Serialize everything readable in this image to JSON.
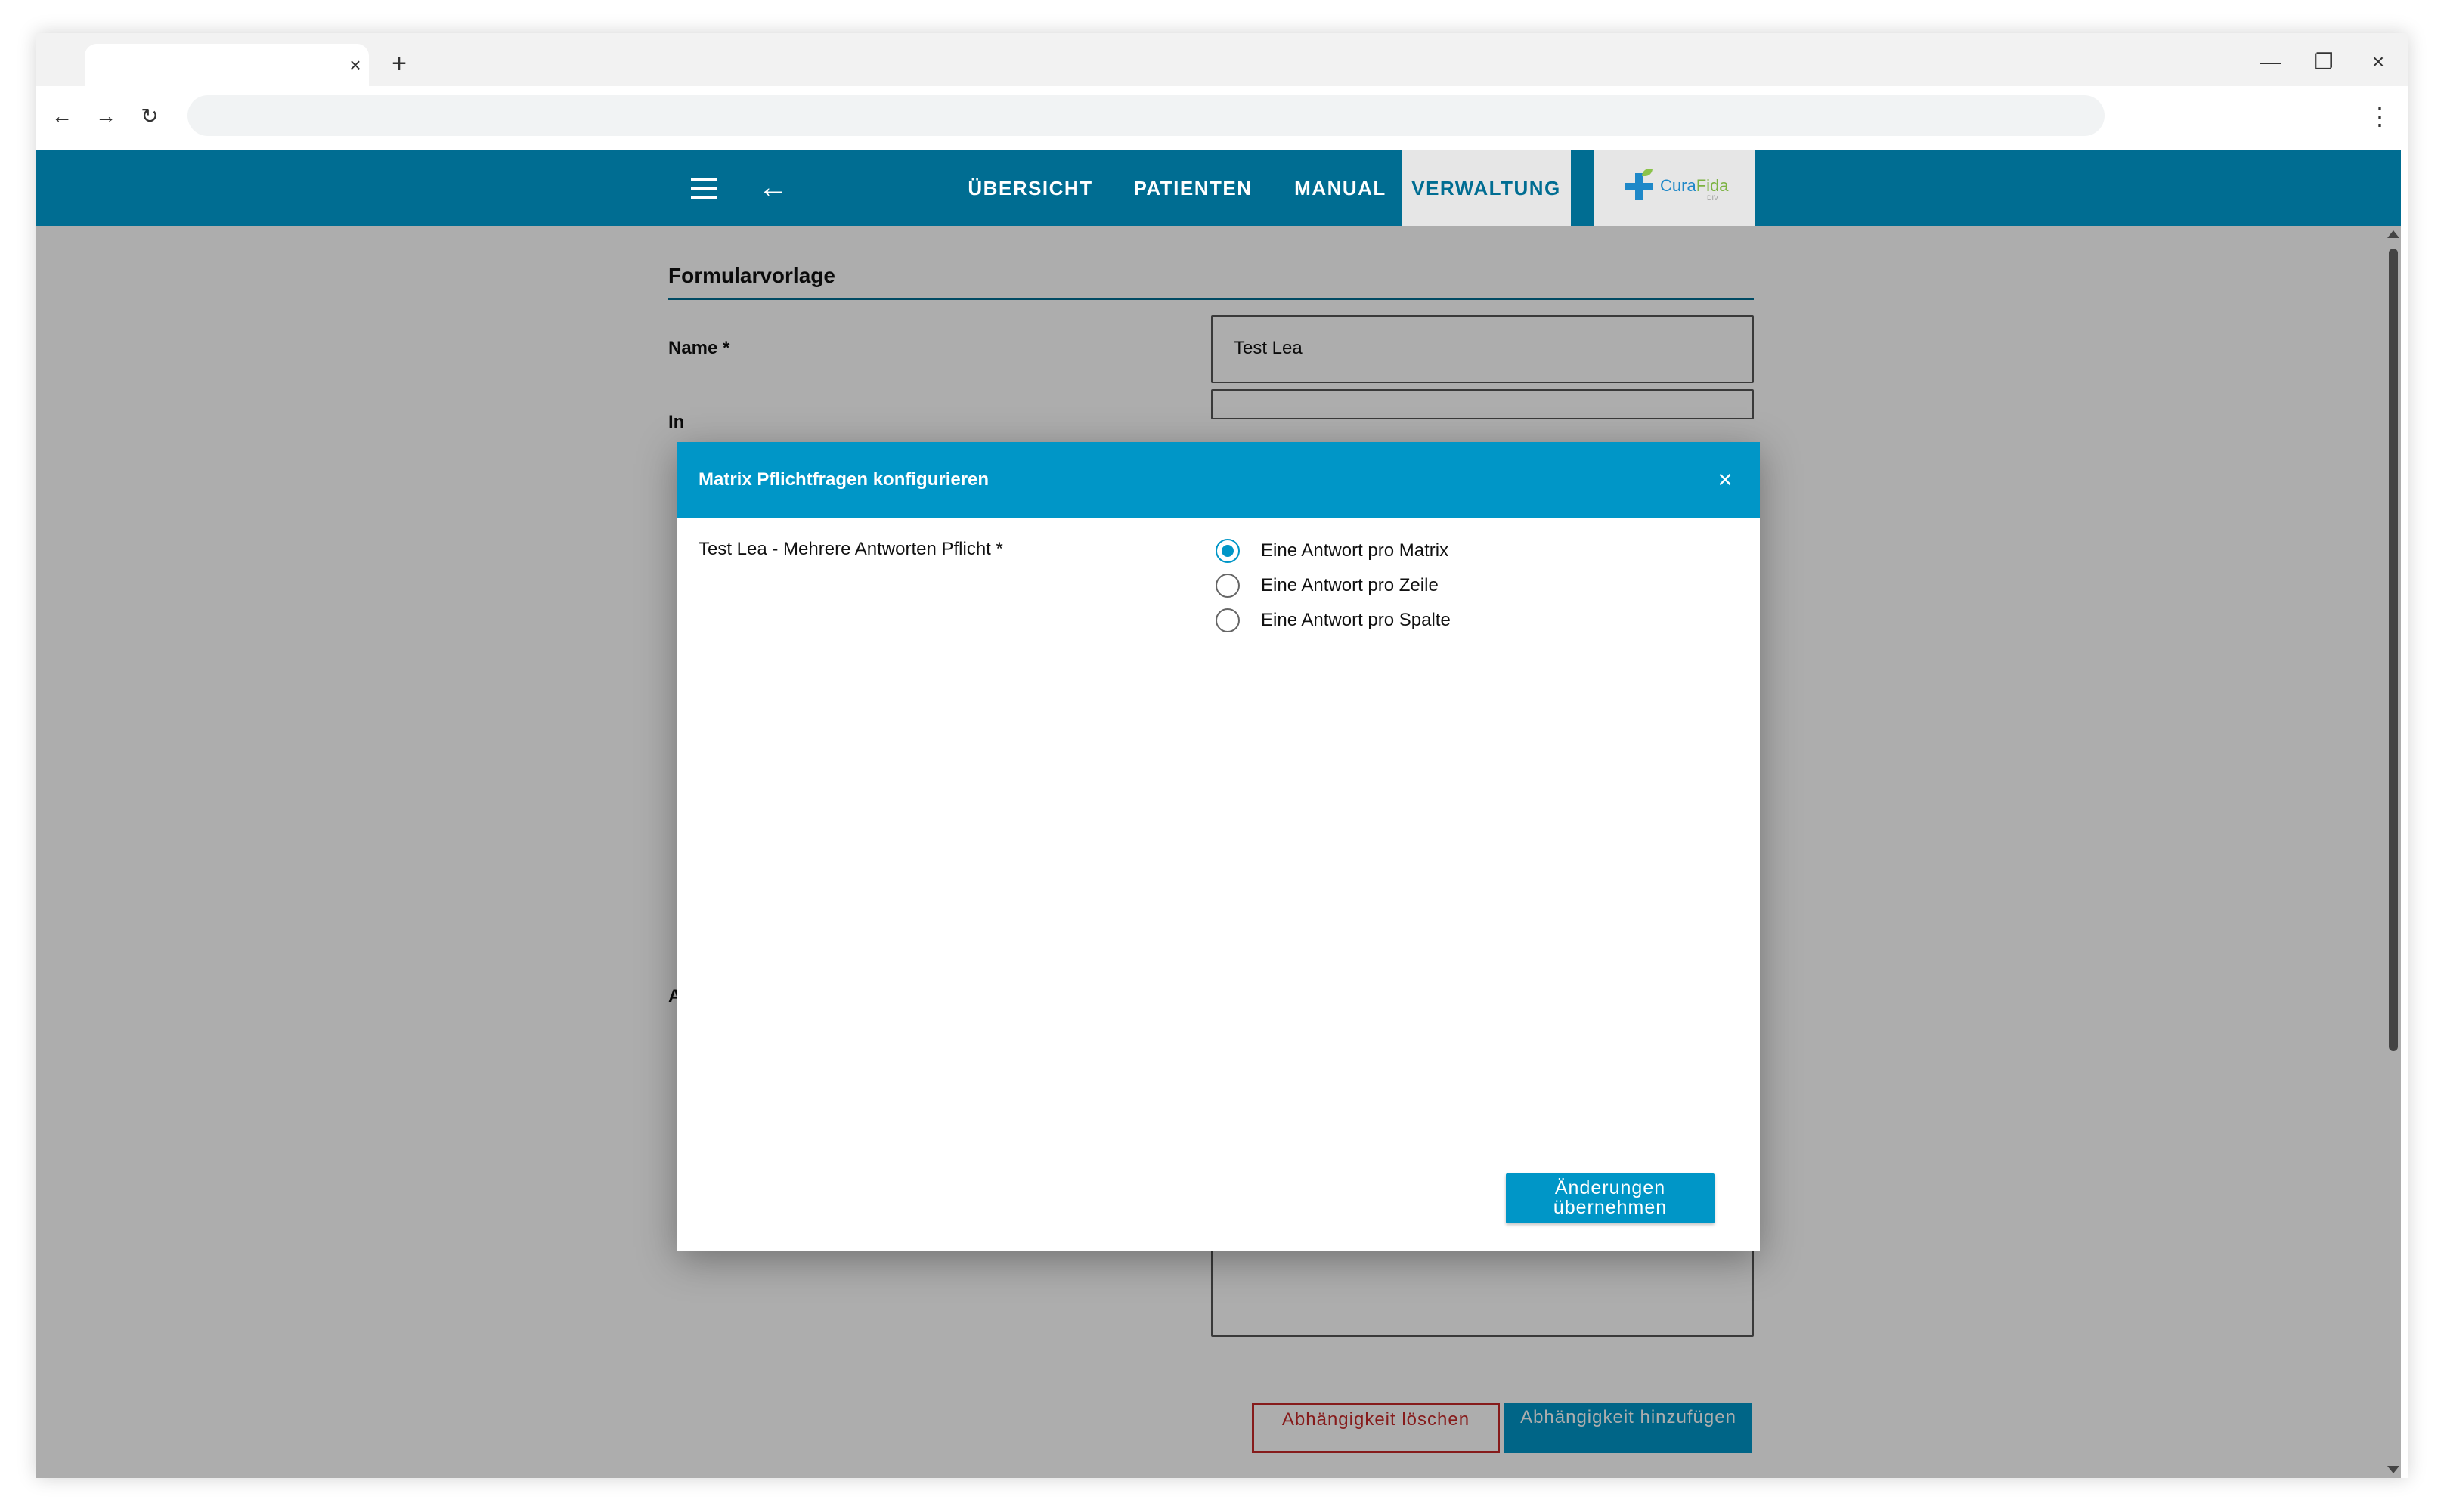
{
  "browser": {
    "tab_close": "×",
    "tab_new": "+",
    "window_minimize": "—",
    "window_restore": "❐",
    "window_close": "×",
    "nav_back": "←",
    "nav_forward": "→",
    "nav_reload": "↻",
    "menu": "⋮"
  },
  "appbar": {
    "nav": [
      {
        "label": "ÜBERSICHT",
        "active": false
      },
      {
        "label": "PATIENTEN",
        "active": false
      },
      {
        "label": "MANUAL",
        "active": false
      },
      {
        "label": "VERWALTUNG",
        "active": true
      }
    ],
    "logo": {
      "part1": "Cura",
      "part2": "Fida",
      "sub": "DIV"
    },
    "colors": {
      "bar": "#006d92",
      "active_tab_bg": "#e6e6e6"
    }
  },
  "form": {
    "title": "Formularvorlage",
    "name_label": "Name *",
    "name_value": "Test Lea",
    "second_label": "In",
    "third_label": "A",
    "delete_dependency": "Abhängigkeit löschen",
    "add_dependency": "Abhängigkeit hinzufügen"
  },
  "dialog": {
    "title": "Matrix Pflichtfragen konfigurieren",
    "close": "×",
    "question": "Test Lea - Mehrere Antworten Pflicht *",
    "options": [
      {
        "label": "Eine Antwort pro Matrix",
        "selected": true
      },
      {
        "label": "Eine Antwort pro Zeile",
        "selected": false
      },
      {
        "label": "Eine Antwort pro Spalte",
        "selected": false
      }
    ],
    "apply": "Änderungen übernehmen",
    "colors": {
      "header": "#0096c7",
      "button": "#0096c7"
    }
  }
}
